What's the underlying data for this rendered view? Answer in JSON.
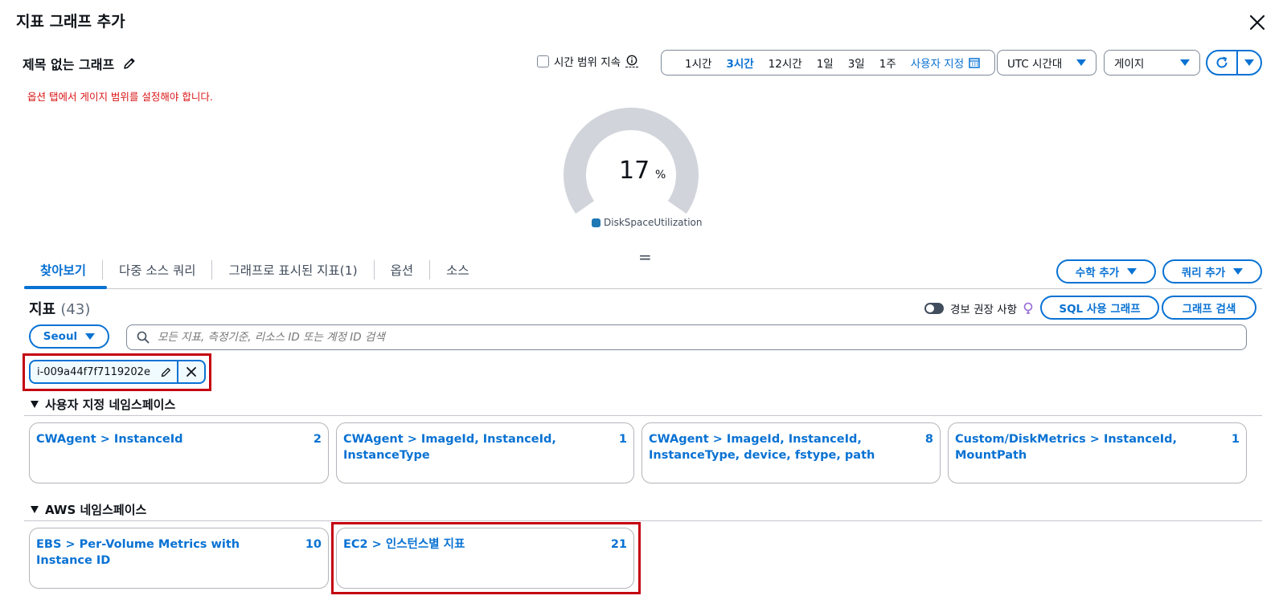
{
  "modal": {
    "title": "지표 그래프 추가"
  },
  "graph": {
    "title": "제목 없는 그래프",
    "warning": "옵션 탭에서 게이지 범위를 설정해야 합니다."
  },
  "time_range": {
    "persist_label": "시간 범위 지속",
    "options": [
      "1시간",
      "3시간",
      "12시간",
      "1일",
      "3일",
      "1주"
    ],
    "active": "3시간",
    "custom_label": "사용자 지정"
  },
  "timezone": {
    "value": "UTC 시간대"
  },
  "chart_type": {
    "value": "게이지"
  },
  "colors": {
    "accent": "#0972d3",
    "gauge_track": "#d1d5db",
    "series": "#1f77b4",
    "error": "#d91515"
  },
  "chart_data": {
    "type": "gauge",
    "value": 17,
    "unit": "%",
    "series": [
      {
        "name": "DiskSpaceUtilization",
        "values": [
          17
        ]
      }
    ]
  },
  "tabs": [
    "찾아보기",
    "다중 소스 쿼리",
    "그래프로 표시된 지표(1)",
    "옵션",
    "소스"
  ],
  "active_tab": "찾아보기",
  "actions": {
    "math": "수학 추가",
    "query": "쿼리 추가",
    "sql": "SQL 사용 그래프",
    "search": "그래프 검색"
  },
  "metrics": {
    "title": "지표",
    "count": "(43)",
    "alarm_label": "경보 권장 사항"
  },
  "region": {
    "value": "Seoul"
  },
  "search": {
    "placeholder": "모든 지표, 측정기준, 리소스 ID 또는 계정 ID 검색"
  },
  "token": {
    "value": "i-009a44f7f7119202e"
  },
  "namespaces": {
    "custom": {
      "label": "사용자 지정 네임스페이스",
      "cards": [
        {
          "title": "CWAgent > InstanceId",
          "count": "2"
        },
        {
          "title": "CWAgent > ImageId, InstanceId, InstanceType",
          "count": "1"
        },
        {
          "title": "CWAgent > ImageId, InstanceId, InstanceType, device, fstype, path",
          "count": "8"
        },
        {
          "title": "Custom/DiskMetrics > InstanceId, MountPath",
          "count": "1"
        }
      ]
    },
    "aws": {
      "label": "AWS 네임스페이스",
      "cards": [
        {
          "title": "EBS > Per-Volume Metrics with Instance ID",
          "count": "10"
        },
        {
          "title": "EC2 > 인스턴스별 지표",
          "count": "21"
        }
      ]
    }
  }
}
